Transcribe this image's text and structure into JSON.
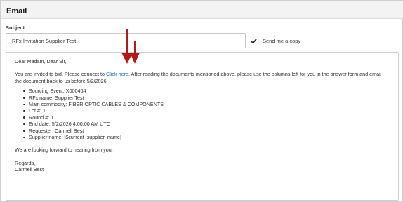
{
  "section": {
    "title": "Email"
  },
  "subject": {
    "label": "Subject",
    "value": "RFx Invitation Supplier Test"
  },
  "send_copy": {
    "label": "Send me a copy",
    "checked": true,
    "icon": "checkmark-icon"
  },
  "message": {
    "greeting": "Dear Madam, Dear Sir,",
    "intro_before_link": "You are invited to bid. Please connect to ",
    "link_text": "Click here",
    "intro_after_link": ". After reading the documents mentioned above, please use the columns left for you in the answer form and email the document back to us before 5/2/2026.",
    "details": [
      "Sourcing Event: X000464",
      "RFx name: Supplier Test",
      "Main commodity: FIBER OPTIC CABLES & COMPONENTS",
      "Lot #: 1",
      "Round #: 1",
      "End date: 5/2/2026 4:00:00 AM UTC",
      "Requester: Carmell Best",
      "Supplier name: [$current_supplier_name]"
    ],
    "closing": "We are looking forward to hearing from you.",
    "regards": "Regards,",
    "signature": "Carmell Best"
  },
  "annotations": {
    "arrow_color": "#b11a1a",
    "icon": "down-arrow-icon"
  }
}
